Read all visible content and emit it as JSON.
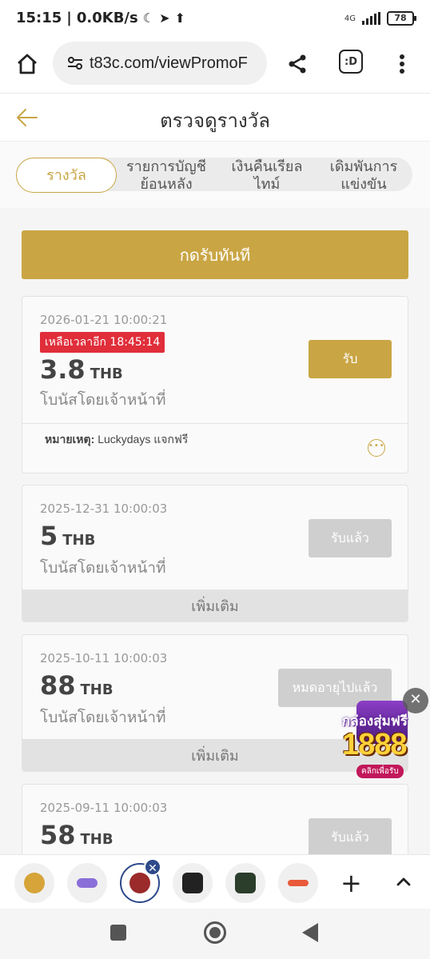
{
  "status_bar": {
    "time": "15:15",
    "net_speed": "0.0KB/s",
    "network": "4G",
    "battery": "78"
  },
  "browser": {
    "url": "t83c.com/viewPromoF",
    "tab_switcher_label": ":D"
  },
  "page": {
    "title": "ตรวจดูรางวัล"
  },
  "tabs": [
    {
      "label": "รางวัล"
    },
    {
      "label": "รายการบัญชีย้อนหลัง"
    },
    {
      "label": "เงินคืนเรียลไทม์"
    },
    {
      "label": "เดิมพันการแข่งขัน"
    }
  ],
  "claim_all_label": "กดรับทันที",
  "cards": [
    {
      "date": "2026-01-21 10:00:21",
      "countdown": "เหลือเวลาอีก 18:45:14",
      "amount": "3.8",
      "currency": "THB",
      "source": "โบนัสโดยเจ้าหน้าที่",
      "button": "รับ",
      "note_label": "หมายเหตุ:",
      "note_text": "Luckydays แจกฟรี"
    },
    {
      "date": "2025-12-31 10:00:03",
      "amount": "5",
      "currency": "THB",
      "source": "โบนัสโดยเจ้าหน้าที่",
      "button": "รับแล้ว",
      "more": "เพิ่มเติม"
    },
    {
      "date": "2025-10-11 10:00:03",
      "amount": "88",
      "currency": "THB",
      "source": "โบนัสโดยเจ้าหน้าที่",
      "button": "หมดอายุไปแล้ว",
      "more": "เพิ่มเติม"
    },
    {
      "date": "2025-09-11 10:00:03",
      "amount": "58",
      "currency": "THB",
      "button": "รับแล้ว"
    }
  ],
  "promo": {
    "line1": "กล่องสุ่มฟรี",
    "line2": "1888",
    "line3": "คลิกเพื่อรับ"
  },
  "colors": {
    "gold": "#c9a544",
    "countdown_red": "#e02e3a",
    "disabled_grey": "#cfcfcf"
  }
}
